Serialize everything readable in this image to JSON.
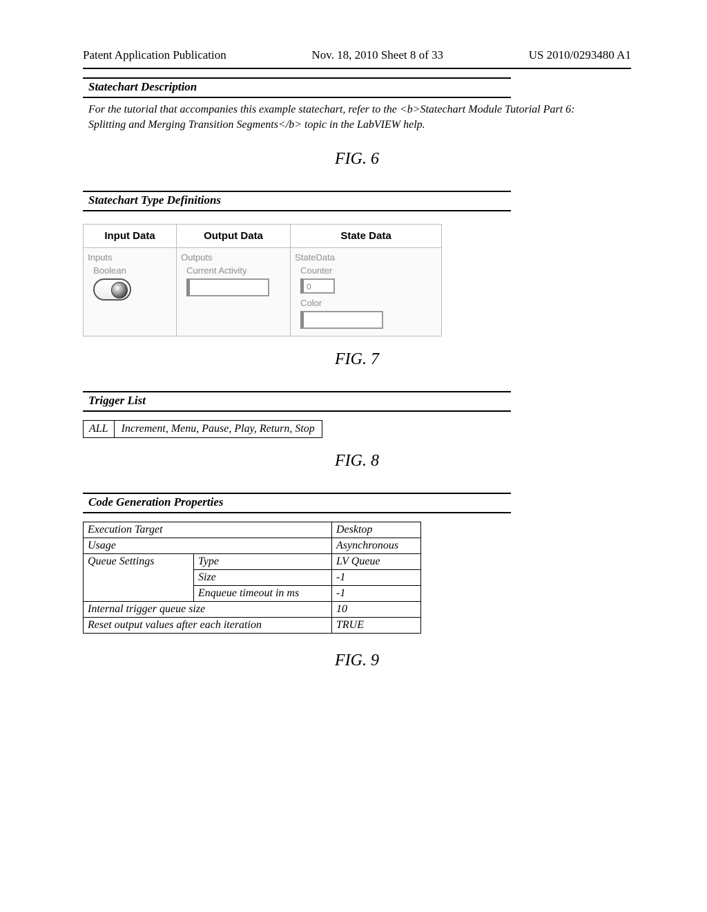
{
  "header": {
    "left": "Patent Application Publication",
    "center": "Nov. 18, 2010  Sheet 8 of 33",
    "right": "US 2010/0293480 A1"
  },
  "fig6": {
    "section_title": "Statechart Description",
    "desc": "For the tutorial that accompanies this example statechart, refer to the <b>Statechart Module Tutorial Part 6: Splitting and Merging Transition Segments</b> topic in the LabVIEW help.",
    "caption": "FIG. 6"
  },
  "fig7": {
    "section_title": "Statechart Type Definitions",
    "cols": {
      "input": {
        "head": "Input Data",
        "cluster": "Inputs",
        "item": "Boolean"
      },
      "output": {
        "head": "Output Data",
        "cluster": "Outputs",
        "item": "Current Activity"
      },
      "state": {
        "head": "State Data",
        "cluster": "StateData",
        "item1": "Counter",
        "item1_val": "0",
        "item2": "Color"
      }
    },
    "caption": "FIG. 7"
  },
  "fig8": {
    "section_title": "Trigger List",
    "all_label": "ALL",
    "triggers": "Increment, Menu, Pause, Play, Return, Stop",
    "caption": "FIG. 8"
  },
  "fig9": {
    "section_title": "Code Generation Properties",
    "rows": {
      "exec_target_k": "Execution Target",
      "exec_target_v": "Desktop",
      "usage_k": "Usage",
      "usage_v": "Asynchronous",
      "queue_k": "Queue Settings",
      "q_type_k": "Type",
      "q_type_v": "LV Queue",
      "q_size_k": "Size",
      "q_size_v": "-1",
      "q_timeout_k": "Enqueue timeout in ms",
      "q_timeout_v": "-1",
      "itq_k": "Internal trigger queue size",
      "itq_v": "10",
      "reset_k": "Reset output values after each iteration",
      "reset_v": "TRUE"
    },
    "caption": "FIG. 9"
  }
}
